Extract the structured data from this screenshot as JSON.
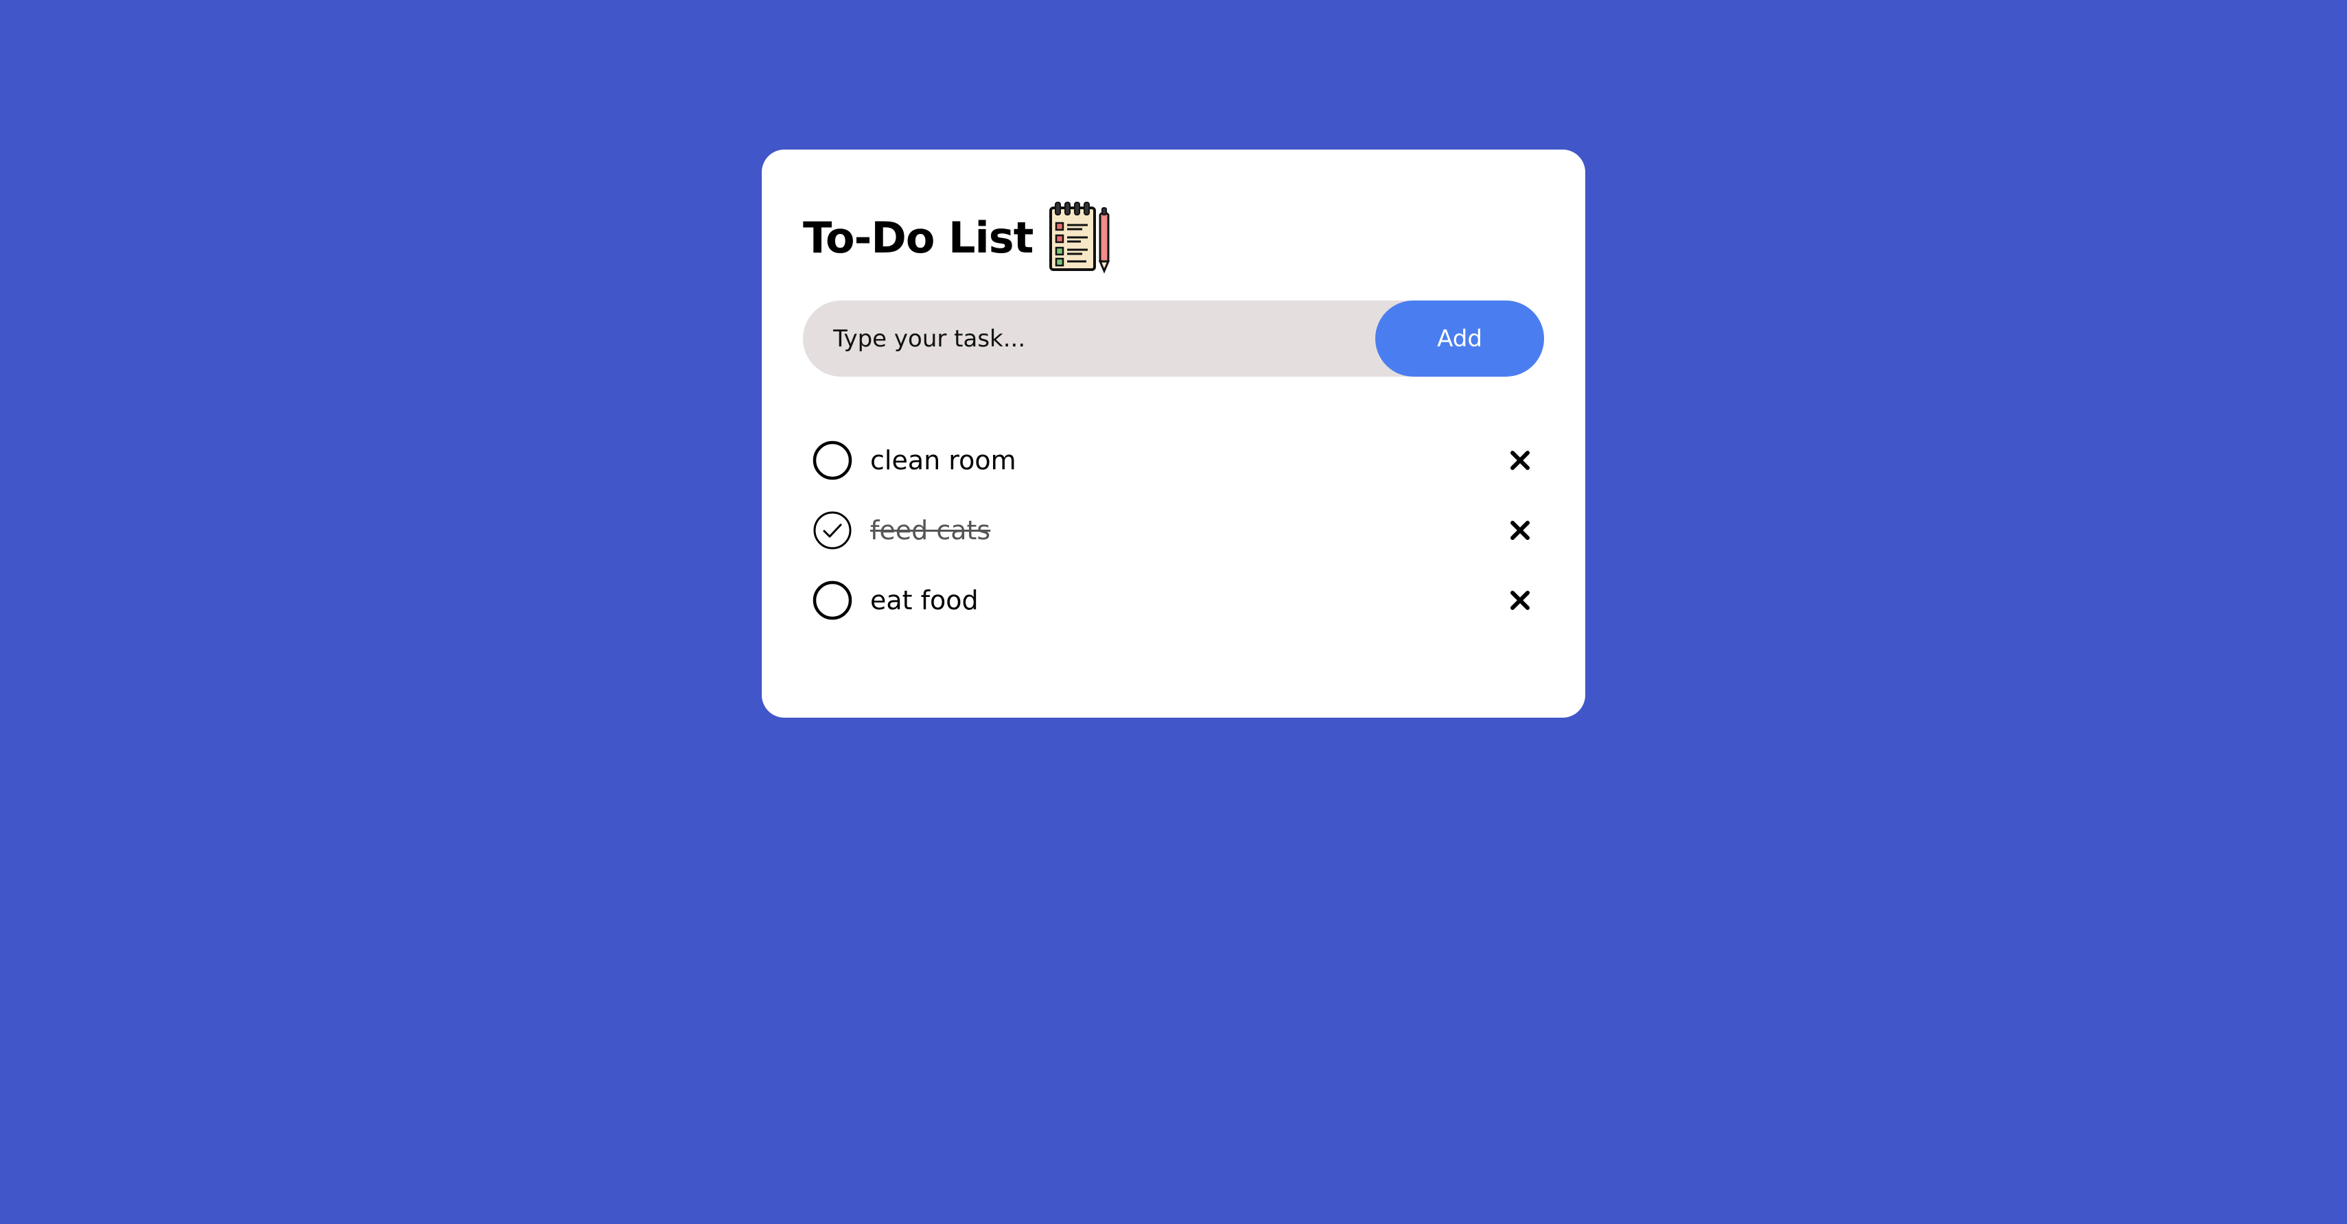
{
  "header": {
    "title": "To-Do List",
    "icon": "notepad-checklist-icon"
  },
  "add_form": {
    "input_value": "",
    "placeholder": "Type your task...",
    "add_label": "Add"
  },
  "tasks": [
    {
      "text": "clean room",
      "done": false
    },
    {
      "text": "feed cats",
      "done": true
    },
    {
      "text": "eat food",
      "done": false
    }
  ],
  "colors": {
    "background": "#4156c8",
    "card": "#ffffff",
    "input_bg": "#e4dede",
    "accent": "#4a7ef0",
    "done_text": "#555555"
  }
}
